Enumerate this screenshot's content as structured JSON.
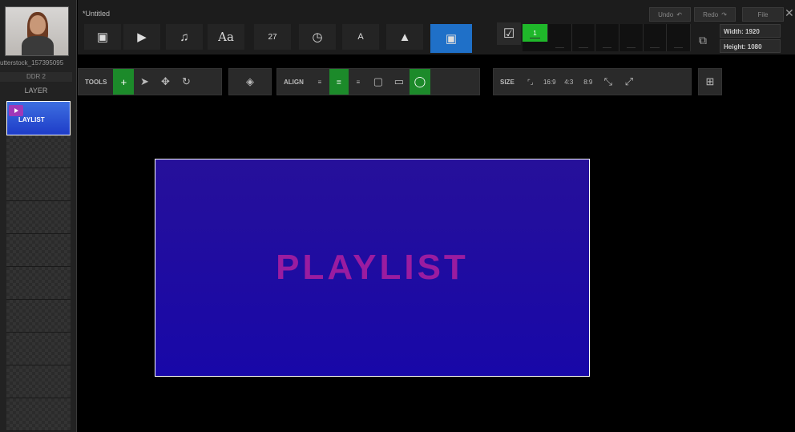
{
  "document": {
    "title": "*Untitled"
  },
  "asset": {
    "file_name": "utterstock_157395095",
    "ddr": "DDR 2"
  },
  "layers": {
    "header": "LAYER",
    "items": [
      {
        "label": "LAYLIST",
        "active": true
      }
    ]
  },
  "history": {
    "undo_label": "Undo",
    "redo_label": "Redo",
    "file_label": "File"
  },
  "media_buttons": [
    {
      "name": "image",
      "glyph": "▣"
    },
    {
      "name": "video",
      "glyph": "▶"
    },
    {
      "name": "music",
      "glyph": "♫"
    },
    {
      "name": "text",
      "glyph": "Aa"
    },
    {
      "name": "calendar",
      "glyph": "27"
    },
    {
      "name": "clock",
      "glyph": "◷"
    },
    {
      "name": "caption",
      "glyph": "A"
    },
    {
      "name": "shapes",
      "glyph": "▲"
    },
    {
      "name": "playlist",
      "glyph": "▣",
      "active": true
    }
  ],
  "timeline": {
    "selected_slot": "1"
  },
  "canvas_size": {
    "width_label": "Width: 1920",
    "height_label": "Height: 1080"
  },
  "tools": {
    "tools_label": "TOOLS",
    "align_label": "ALIGN",
    "size_label": "SIZE",
    "ratios": [
      "16:9",
      "4:3",
      "8:9"
    ]
  },
  "canvas": {
    "text": "PLAYLIST",
    "bg_color": "#1e0ea6",
    "text_color": "#9a1ca0"
  },
  "colors": {
    "accent_blue": "#1f70c8",
    "accent_green": "#1c8a2a",
    "timeline_green": "#1fb82a"
  }
}
